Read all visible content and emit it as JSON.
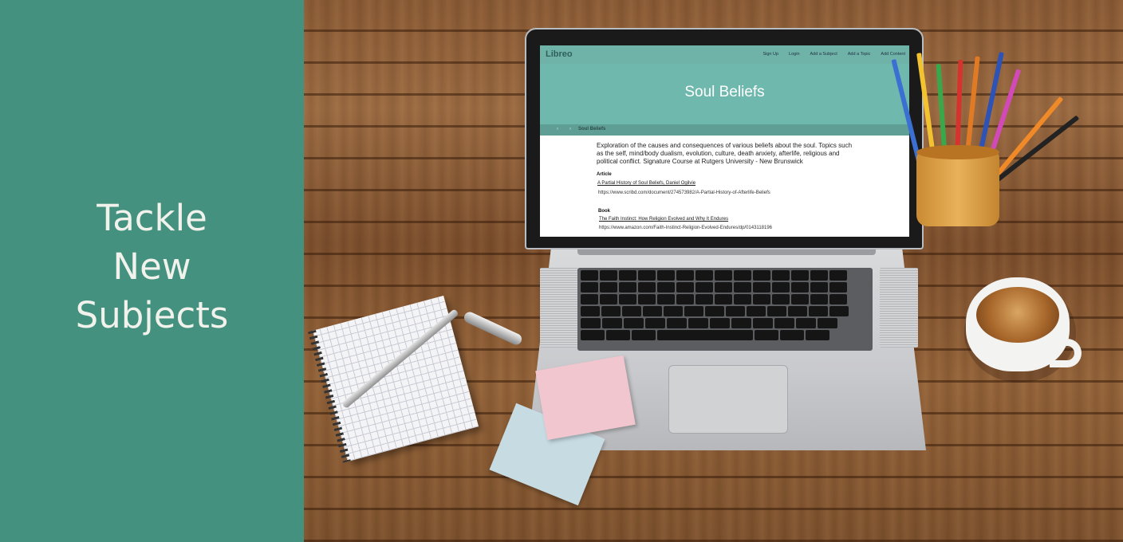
{
  "promo": {
    "tagline_line1": "Tackle",
    "tagline_line2": "New",
    "tagline_line3": "Subjects"
  },
  "site": {
    "logo": "Libreo",
    "nav": [
      "Sign Up",
      "Login",
      "Add a Subject",
      "Add a Topic",
      "Add Content"
    ],
    "page_title": "Soul Beliefs",
    "breadcrumb": {
      "sep1": "›",
      "sep2": "›",
      "current": "Soul Beliefs"
    },
    "description": "Exploration of the causes and consequences of various beliefs about the soul. Topics such as the self, mind/body dualism, evolution, culture, death anxiety, afterlife, religious and political conflict. Signature Course at Rutgers University - New Brunswick",
    "resources": [
      {
        "type": "Article",
        "title": "A Partial History of Soul Beliefs, Daniel Ogilvie",
        "url": "https://www.scribd.com/document/274573982/A-Partial-History-of-Afterlife-Beliefs"
      },
      {
        "type": "Book",
        "title": "The Faith Instinct: How Religion Evolved and Why It Endures",
        "url": "https://www.amazon.com/Faith-Instinct-Religion-Evolved-Endures/dp/0143118196"
      }
    ]
  },
  "colors": {
    "panel": "#44917f",
    "header": "#6fb3a8",
    "hero": "#6fb8ad",
    "breadcrumb_bar": "#5e9e95"
  }
}
